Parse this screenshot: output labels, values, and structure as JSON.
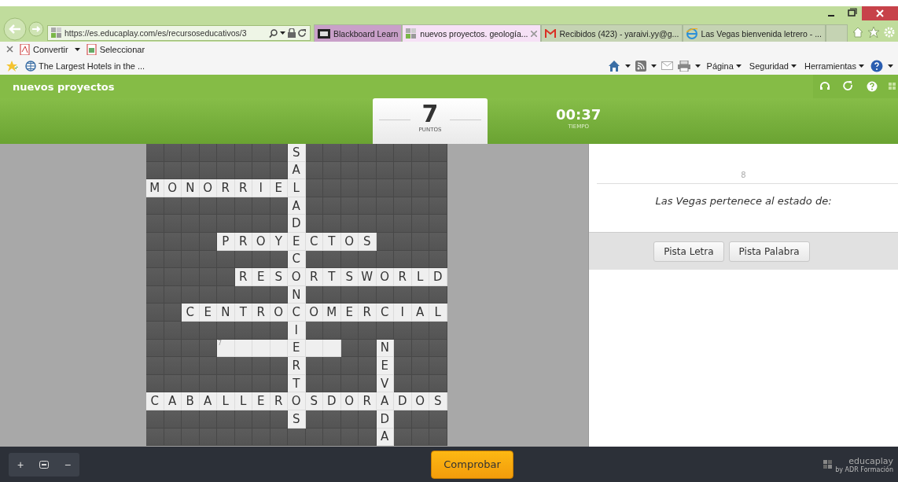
{
  "browser": {
    "url": "https://es.educaplay.com/es/recursoseducativos/3",
    "tabs": [
      {
        "label": "Blackboard Learn",
        "selected": false
      },
      {
        "label": "nuevos proyectos. geología...",
        "selected": true
      },
      {
        "label": "Recibidos (423) - yaraivi.yy@g...",
        "selected": false
      },
      {
        "label": "Las Vegas bienvenida letrero - ...",
        "selected": false
      }
    ],
    "toolbar": [
      "Convertir",
      "Seleccionar"
    ],
    "favorites": [
      "The Largest Hotels in the ..."
    ],
    "commands": [
      "Página",
      "Seguridad",
      "Herramientas"
    ]
  },
  "app": {
    "title": "nuevos proyectos",
    "score": {
      "value": "7",
      "label": "PUNTOS"
    },
    "timer": {
      "value": "00:37",
      "label": "TIEMPO"
    }
  },
  "crossword": {
    "rows": [
      [
        null,
        null,
        null,
        null,
        null,
        null,
        null,
        null,
        "S",
        null,
        null,
        null,
        null,
        null,
        null,
        null,
        null
      ],
      [
        null,
        null,
        null,
        null,
        null,
        null,
        null,
        null,
        "A",
        null,
        null,
        null,
        null,
        null,
        null,
        null,
        null
      ],
      [
        "M",
        "O",
        "N",
        "O",
        "R",
        "R",
        "I",
        "E",
        "L",
        null,
        null,
        null,
        null,
        null,
        null,
        null,
        null
      ],
      [
        null,
        null,
        null,
        null,
        null,
        null,
        null,
        null,
        "A",
        null,
        null,
        null,
        null,
        null,
        null,
        null,
        null
      ],
      [
        null,
        null,
        null,
        null,
        null,
        null,
        null,
        null,
        "D",
        null,
        null,
        null,
        null,
        null,
        null,
        null,
        null
      ],
      [
        null,
        null,
        null,
        null,
        "P",
        "R",
        "O",
        "Y",
        "E",
        "C",
        "T",
        "O",
        "S",
        null,
        null,
        null,
        null
      ],
      [
        null,
        null,
        null,
        null,
        null,
        null,
        null,
        null,
        "C",
        null,
        null,
        null,
        null,
        null,
        null,
        null,
        null
      ],
      [
        null,
        null,
        null,
        null,
        null,
        "R",
        "E",
        "S",
        "O",
        "R",
        "T",
        "S",
        "W",
        "O",
        "R",
        "L",
        "D"
      ],
      [
        null,
        null,
        null,
        null,
        null,
        null,
        null,
        null,
        "N",
        null,
        null,
        null,
        null,
        null,
        null,
        null,
        null
      ],
      [
        null,
        null,
        "C",
        "E",
        "N",
        "T",
        "R",
        "O",
        "C",
        "O",
        "M",
        "E",
        "R",
        "C",
        "I",
        "A",
        "L"
      ],
      [
        null,
        null,
        null,
        null,
        null,
        null,
        null,
        null,
        "I",
        null,
        null,
        null,
        null,
        null,
        null,
        null,
        null
      ],
      [
        null,
        null,
        null,
        null,
        {
          "kind": "empty",
          "number": "7"
        },
        {
          "kind": "empty"
        },
        {
          "kind": "empty"
        },
        {
          "kind": "empty"
        },
        "E",
        {
          "kind": "empty"
        },
        {
          "kind": "empty"
        },
        null,
        null,
        "N",
        null,
        null,
        null
      ],
      [
        null,
        null,
        null,
        null,
        null,
        null,
        null,
        null,
        "R",
        null,
        null,
        null,
        null,
        "E",
        null,
        null,
        null
      ],
      [
        null,
        null,
        null,
        null,
        null,
        null,
        null,
        null,
        "T",
        null,
        null,
        null,
        null,
        "V",
        null,
        null,
        null
      ],
      [
        "C",
        "A",
        "B",
        "A",
        "L",
        "L",
        "E",
        "R",
        "O",
        "S",
        "D",
        "O",
        "R",
        "A",
        "D",
        "O",
        "S"
      ],
      [
        null,
        null,
        null,
        null,
        null,
        null,
        null,
        null,
        "S",
        null,
        null,
        null,
        null,
        "D",
        null,
        null,
        null
      ],
      [
        null,
        null,
        null,
        null,
        null,
        null,
        null,
        null,
        null,
        null,
        null,
        null,
        null,
        "A",
        null,
        null,
        null
      ]
    ]
  },
  "clue": {
    "number": "8",
    "text": "Las Vegas pertenece al estado de:",
    "buttons": [
      "Pista Letra",
      "Pista Palabra"
    ]
  },
  "footer": {
    "zoom_buttons": [
      {
        "kind": "text",
        "label": "+"
      },
      {
        "kind": "icon"
      },
      {
        "kind": "text",
        "label": "−"
      }
    ],
    "check_button": "Comprobar",
    "brand": "educaplay",
    "brand_sub": "by ADR Formación"
  }
}
